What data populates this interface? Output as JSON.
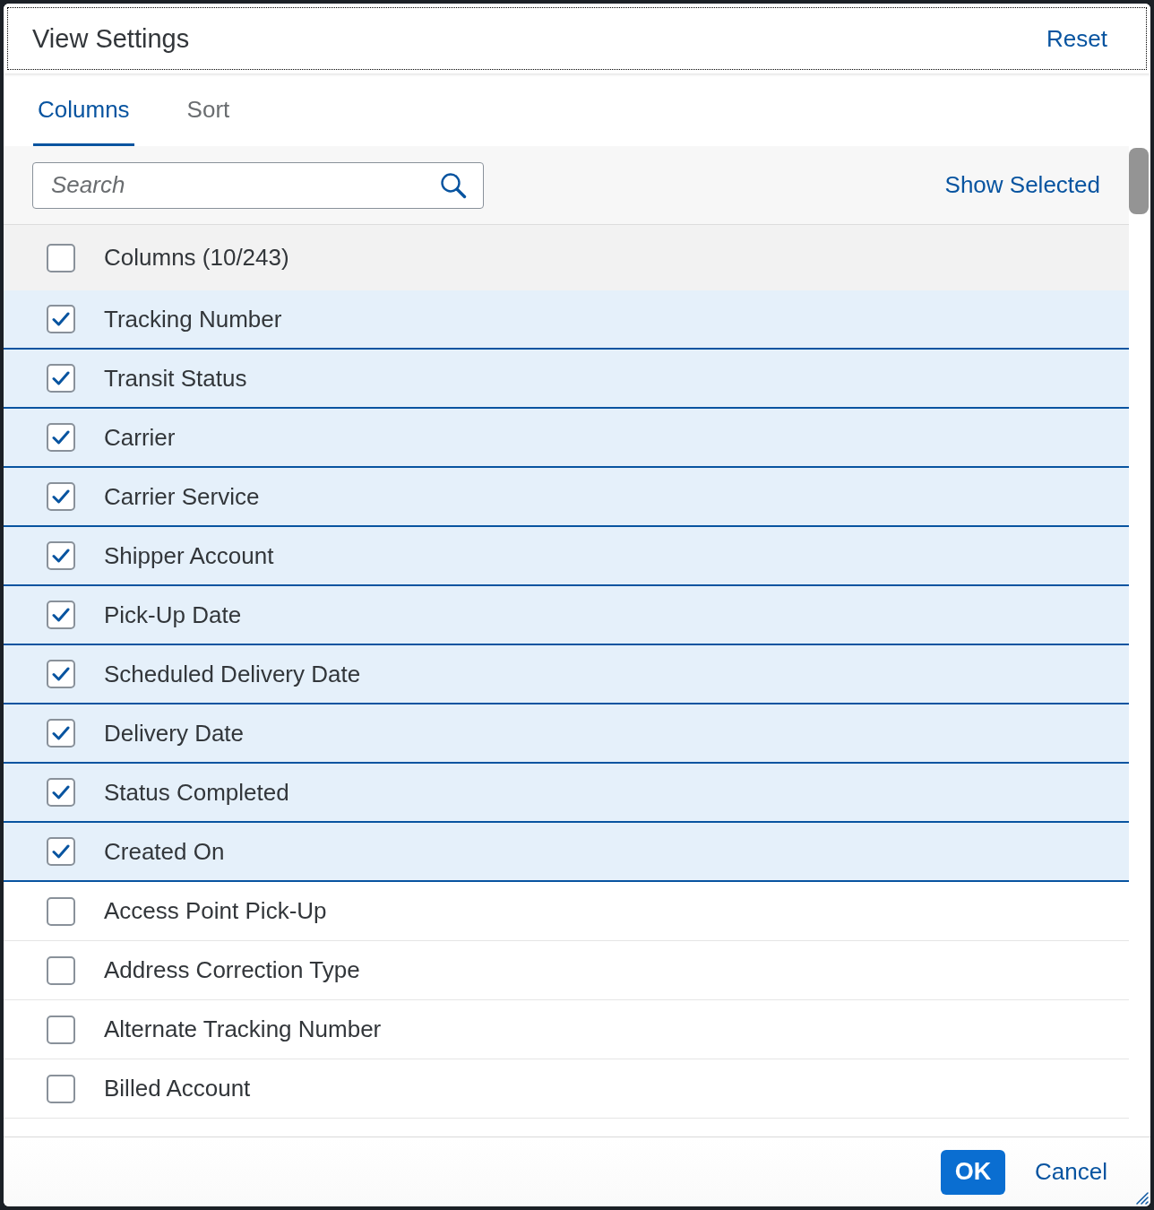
{
  "dialog": {
    "title": "View Settings",
    "reset_label": "Reset"
  },
  "tabs": [
    {
      "label": "Columns",
      "selected": true
    },
    {
      "label": "Sort",
      "selected": false
    }
  ],
  "toolbar": {
    "search": {
      "placeholder": "Search"
    },
    "show_selected_label": "Show Selected"
  },
  "list": {
    "header": {
      "label": "Columns (10/243)",
      "checked": false
    },
    "rows": [
      {
        "label": "Tracking Number",
        "checked": true
      },
      {
        "label": "Transit Status",
        "checked": true
      },
      {
        "label": "Carrier",
        "checked": true
      },
      {
        "label": "Carrier Service",
        "checked": true
      },
      {
        "label": "Shipper Account",
        "checked": true
      },
      {
        "label": "Pick-Up Date",
        "checked": true
      },
      {
        "label": "Scheduled Delivery Date",
        "checked": true
      },
      {
        "label": "Delivery Date",
        "checked": true
      },
      {
        "label": "Status Completed",
        "checked": true
      },
      {
        "label": "Created On",
        "checked": true
      },
      {
        "label": "Access Point Pick-Up",
        "checked": false
      },
      {
        "label": "Address Correction Type",
        "checked": false
      },
      {
        "label": "Alternate Tracking Number",
        "checked": false
      },
      {
        "label": "Billed Account",
        "checked": false
      }
    ]
  },
  "footer": {
    "buttons": [
      {
        "label": "OK",
        "kind": "primary"
      },
      {
        "label": "Cancel",
        "kind": "transparent"
      }
    ]
  }
}
